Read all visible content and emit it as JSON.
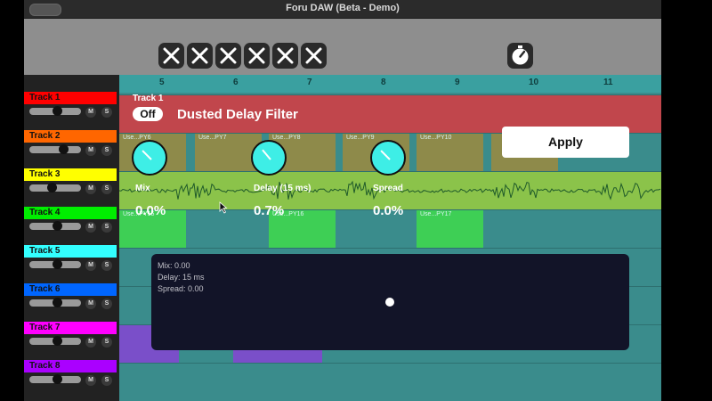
{
  "window": {
    "title": "Foru DAW (Beta - Demo)"
  },
  "toolbar": {
    "close_buttons": [
      "close-1",
      "close-2",
      "close-3",
      "close-4",
      "close-5",
      "close-6"
    ],
    "timer_icon": "timer-icon"
  },
  "ruler": {
    "marks": [
      "5",
      "6",
      "7",
      "8",
      "9",
      "10",
      "11"
    ]
  },
  "tracks": [
    {
      "name": "Track 1",
      "color": "#ff0000",
      "volume": 0.55
    },
    {
      "name": "Track 2",
      "color": "#ff6600",
      "volume": 0.65
    },
    {
      "name": "Track 3",
      "color": "#ffff00",
      "volume": 0.45
    },
    {
      "name": "Track 4",
      "color": "#00ee00",
      "volume": 0.55
    },
    {
      "name": "Track 5",
      "color": "#33ffff",
      "volume": 0.55
    },
    {
      "name": "Track 6",
      "color": "#0066ff",
      "volume": 0.55
    },
    {
      "name": "Track 7",
      "color": "#ff00ff",
      "volume": 0.55
    },
    {
      "name": "Track 8",
      "color": "#aa00ff",
      "volume": 0.55
    }
  ],
  "track_buttons": {
    "mute": "M",
    "solo": "S"
  },
  "clips": {
    "track2": [
      "Use...PY6",
      "Use...PY7",
      "Use...PY8",
      "Use...PY9",
      "Use...PY10"
    ],
    "track4": [
      "Use...PY15",
      "Use...PY16",
      "Use...PY17"
    ]
  },
  "effect": {
    "track_label": "Track 1",
    "toggle": "Off",
    "name": "Dusted Delay Filter",
    "apply_label": "Apply",
    "knobs": [
      {
        "label": "Mix",
        "value": "0.0%",
        "angle": -45
      },
      {
        "label": "Delay (15 ms)",
        "value": "0.7%",
        "angle": -40
      },
      {
        "label": "Spread",
        "value": "0.0%",
        "angle": -45
      }
    ],
    "readouts": {
      "mix": "Mix: 0.00",
      "delay": "Delay: 15 ms",
      "spread": "Spread: 0.00"
    }
  },
  "colors": {
    "lane_bg": "#3a8c8c",
    "track3_lane": "#8bc34a",
    "track1_lane": "#c1464c"
  }
}
